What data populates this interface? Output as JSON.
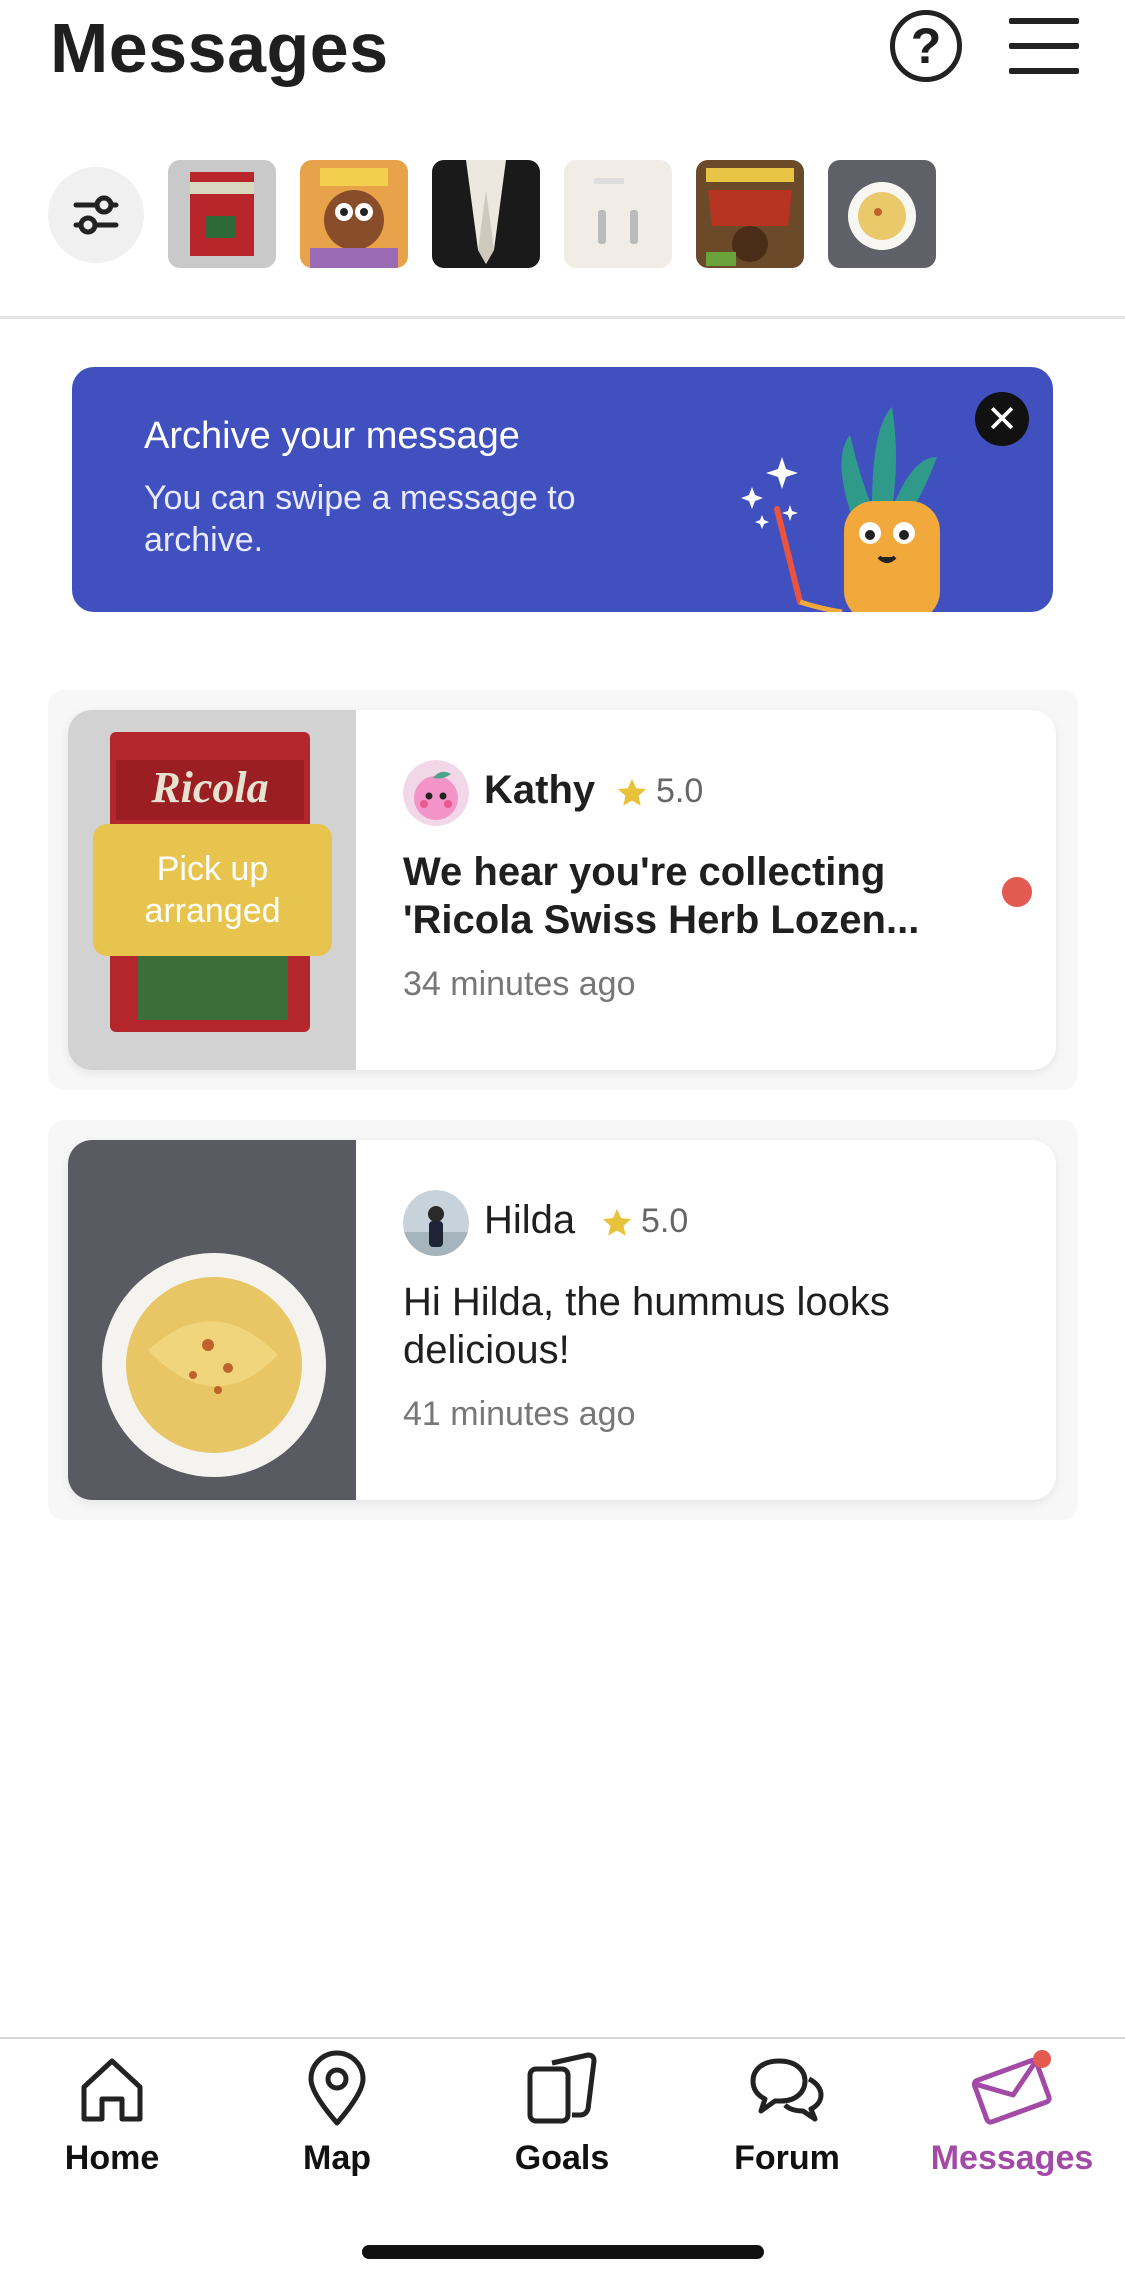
{
  "header": {
    "title": "Messages",
    "help_glyph": "?"
  },
  "filter_bar": {
    "thumbnails": [
      "ricola",
      "cheeky-pops",
      "shoe",
      "cables",
      "koko-krunch",
      "hummus"
    ]
  },
  "banner": {
    "title": "Archive your message",
    "body": "You can swipe a message to archive.",
    "close_glyph": "✕",
    "color": "#4150bf"
  },
  "conversations": [
    {
      "name": "Kathy",
      "rating": "5.0",
      "message": "We hear you're collecting 'Ricola Swiss Herb Lozen...",
      "time": "34 minutes ago",
      "badge": "Pick up arranged",
      "unread": true
    },
    {
      "name": "Hilda",
      "rating": "5.0",
      "message": "Hi Hilda, the hummus looks delicious!",
      "time": "41 minutes ago",
      "unread": false
    }
  ],
  "nav": {
    "items": [
      {
        "label": "Home",
        "icon": "home-icon"
      },
      {
        "label": "Map",
        "icon": "map-pin-icon"
      },
      {
        "label": "Goals",
        "icon": "goals-icon"
      },
      {
        "label": "Forum",
        "icon": "forum-icon"
      },
      {
        "label": "Messages",
        "icon": "envelope-icon",
        "active": true
      }
    ],
    "active_color": "#a34aa7"
  },
  "colors": {
    "unread_dot": "#e35a50",
    "badge": "#e6c44d",
    "star": "#e8c23a"
  }
}
